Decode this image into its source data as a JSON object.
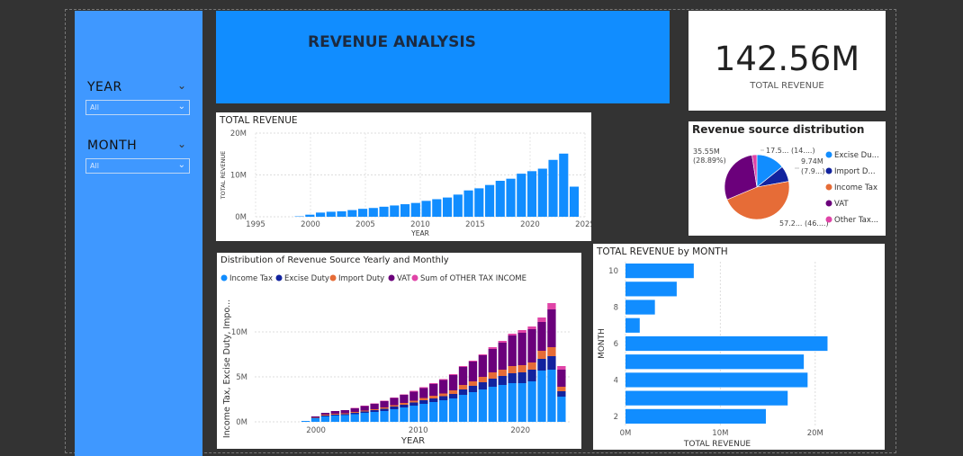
{
  "colors": {
    "background": "#333333",
    "slicer_panel": "#3f98ff",
    "banner": "#118dff",
    "bar": "#118dff",
    "income_tax": "#118dff",
    "excise_duty": "#12239e",
    "import_duty": "#e66c37",
    "vat": "#6b007b",
    "other_tax": "#e044a7"
  },
  "slicers": {
    "year": {
      "title": "YEAR",
      "value": "All",
      "icon": "chevron-down-icon"
    },
    "month": {
      "title": "MONTH",
      "value": "All",
      "icon": "chevron-down-icon"
    }
  },
  "banner": {
    "title": "REVENUE ANALYSIS"
  },
  "kpi": {
    "value": "142.56M",
    "label": "TOTAL REVENUE"
  },
  "total_revenue_chart": {
    "title": "TOTAL REVENUE",
    "chart_data": {
      "type": "bar",
      "xlabel": "YEAR",
      "ylabel": "TOTAL REVENUE",
      "x": [
        1999,
        2000,
        2001,
        2002,
        2003,
        2004,
        2005,
        2006,
        2007,
        2008,
        2009,
        2010,
        2011,
        2012,
        2013,
        2014,
        2015,
        2016,
        2017,
        2018,
        2019,
        2020,
        2021,
        2022,
        2023,
        2024
      ],
      "values": [
        0.1,
        0.5,
        1.0,
        1.2,
        1.3,
        1.6,
        1.9,
        2.1,
        2.4,
        2.7,
        3.0,
        3.3,
        3.8,
        4.2,
        4.6,
        5.3,
        6.3,
        6.8,
        7.6,
        8.6,
        9.1,
        10.3,
        10.9,
        11.5,
        13.6,
        15.1,
        7.2
      ],
      "xticks": [
        "1995",
        "2000",
        "2005",
        "2010",
        "2015",
        "2020",
        "2025"
      ],
      "yticks": [
        "0M",
        "10M",
        "20M"
      ],
      "ylim": [
        0,
        20
      ]
    }
  },
  "pie_chart": {
    "title": "Revenue source distribution",
    "chart_data": {
      "type": "pie",
      "slices": [
        {
          "label": "Excise Du...",
          "value": 17.5,
          "display": "17.5... (14....)"
        },
        {
          "label": "Import D...",
          "value": 9.74,
          "display": "9.74M (7.9...)"
        },
        {
          "label": "Income Tax",
          "value": 57.2,
          "display": "57.2... (46....)"
        },
        {
          "label": "VAT",
          "value": 35.55,
          "display": "35.55M (28.89%)"
        },
        {
          "label": "Other Tax...",
          "value": 3.0,
          "display": ""
        }
      ]
    },
    "data_labels": {
      "top_left_value": "35.55M",
      "top_left_pct": "(28.89%)",
      "top_a": "17.5... (14....)",
      "top_b_value": "9.74M",
      "top_b_pct": "(7.9...)",
      "bottom": "57.2... (46....)"
    },
    "legend": [
      "Excise Du...",
      "Import D...",
      "Income Tax",
      "VAT",
      "Other Tax..."
    ]
  },
  "stacked_chart": {
    "title": "Distribution of Revenue Source Yearly and Monthly",
    "legend": [
      "Income Tax",
      "Excise Duty",
      "Import Duty",
      "VAT",
      "Sum of OTHER TAX INCOME"
    ],
    "chart_data": {
      "type": "bar",
      "xlabel": "YEAR",
      "ylabel": "Income Tax, Excise Duty, Impo...",
      "x": [
        1999,
        2000,
        2001,
        2002,
        2003,
        2004,
        2005,
        2006,
        2007,
        2008,
        2009,
        2010,
        2011,
        2012,
        2013,
        2014,
        2015,
        2016,
        2017,
        2018,
        2019,
        2020,
        2021,
        2022,
        2023,
        2024
      ],
      "series": [
        {
          "name": "Income Tax",
          "values": [
            0.1,
            0.4,
            0.6,
            0.7,
            0.75,
            0.85,
            1.0,
            1.1,
            1.2,
            1.4,
            1.6,
            1.8,
            2.0,
            2.2,
            2.4,
            2.6,
            3.0,
            3.3,
            3.6,
            3.9,
            4.1,
            4.3,
            4.3,
            4.5,
            5.7,
            5.8,
            2.8
          ]
        },
        {
          "name": "Excise Duty",
          "values": [
            0.0,
            0.05,
            0.1,
            0.1,
            0.1,
            0.15,
            0.15,
            0.2,
            0.25,
            0.3,
            0.3,
            0.35,
            0.4,
            0.4,
            0.45,
            0.5,
            0.6,
            0.7,
            0.8,
            0.9,
            1.0,
            1.1,
            1.2,
            1.3,
            1.3,
            1.5,
            0.6
          ]
        },
        {
          "name": "Import Duty",
          "values": [
            0.0,
            0.05,
            0.1,
            0.1,
            0.1,
            0.1,
            0.1,
            0.1,
            0.15,
            0.15,
            0.2,
            0.2,
            0.25,
            0.3,
            0.3,
            0.4,
            0.5,
            0.5,
            0.6,
            0.7,
            0.7,
            0.8,
            0.8,
            0.8,
            0.9,
            1.0,
            0.5
          ]
        },
        {
          "name": "VAT",
          "values": [
            0.0,
            0.1,
            0.2,
            0.3,
            0.35,
            0.4,
            0.5,
            0.6,
            0.7,
            0.8,
            0.9,
            1.0,
            1.1,
            1.3,
            1.5,
            1.7,
            2.0,
            2.2,
            2.4,
            2.6,
            3.0,
            3.4,
            3.6,
            3.7,
            3.2,
            4.2,
            1.9
          ]
        },
        {
          "name": "Sum of OTHER TAX INCOME",
          "values": [
            0.0,
            0.0,
            0.0,
            0.0,
            0.0,
            0.05,
            0.05,
            0.05,
            0.05,
            0.05,
            0.05,
            0.1,
            0.1,
            0.1,
            0.1,
            0.1,
            0.1,
            0.1,
            0.1,
            0.2,
            0.2,
            0.2,
            0.3,
            0.3,
            0.5,
            0.7,
            0.4
          ]
        }
      ],
      "xticks": [
        "2000",
        "2010",
        "2020"
      ],
      "yticks": [
        "0M",
        "5M",
        "10M"
      ],
      "ylim": [
        0,
        13
      ]
    }
  },
  "month_chart": {
    "title": "TOTAL REVENUE by MONTH",
    "chart_data": {
      "type": "bar",
      "orientation": "horizontal",
      "xlabel": "TOTAL REVENUE",
      "ylabel": "MONTH",
      "categories": [
        "10",
        "9",
        "8",
        "7",
        "6",
        "5",
        "4",
        "3",
        "2"
      ],
      "values": [
        7.2,
        5.4,
        3.1,
        1.5,
        21.3,
        18.8,
        19.2,
        17.1,
        14.8
      ],
      "yticks": [
        "10",
        "8",
        "6",
        "4",
        "2"
      ],
      "xticks": [
        "0M",
        "10M",
        "20M"
      ],
      "xlim": [
        0,
        26
      ]
    }
  }
}
